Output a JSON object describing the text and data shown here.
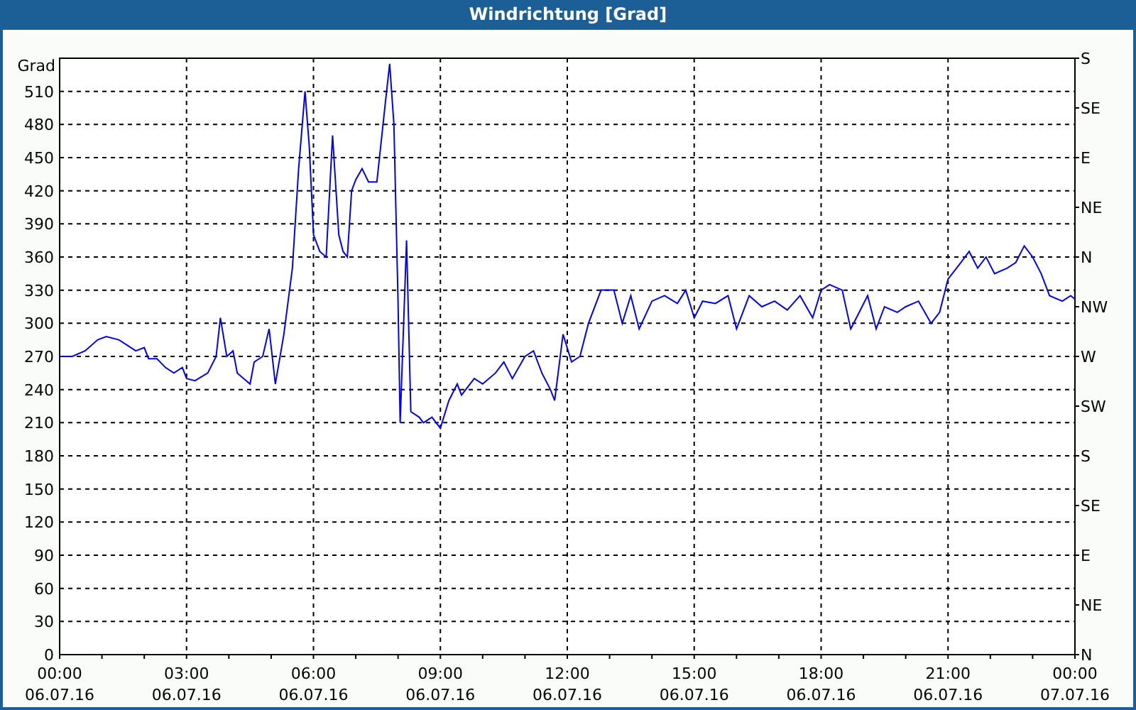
{
  "window": {
    "title": "Windrichtung [Grad]"
  },
  "chart": {
    "x_axis_dates": [
      "06.07.16",
      "06.07.16",
      "06.07.16",
      "06.07.16",
      "06.07.16",
      "06.07.16",
      "06.07.16",
      "06.07.16",
      "07.07.16"
    ],
    "compass_labels": [
      "S",
      "SE",
      "E",
      "NE",
      "N",
      "NW",
      "W",
      "SW",
      "S",
      "SE",
      "E",
      "NE",
      "N"
    ],
    "chart_data": {
      "type": "line",
      "grid": true,
      "ylabel": "Grad",
      "xlim": [
        0,
        24
      ],
      "ylim": [
        0,
        540
      ],
      "xticks": [
        {
          "value": 0,
          "label": "00:00"
        },
        {
          "value": 3,
          "label": "03:00"
        },
        {
          "value": 6,
          "label": "06:00"
        },
        {
          "value": 9,
          "label": "09:00"
        },
        {
          "value": 12,
          "label": "12:00"
        },
        {
          "value": 15,
          "label": "15:00"
        },
        {
          "value": 18,
          "label": "18:00"
        },
        {
          "value": 21,
          "label": "21:00"
        },
        {
          "value": 24,
          "label": "00:00"
        }
      ],
      "yticks": [
        0,
        30,
        60,
        90,
        120,
        150,
        180,
        210,
        240,
        270,
        300,
        330,
        360,
        390,
        420,
        450,
        480,
        510
      ],
      "x": [
        0,
        0.3,
        0.6,
        0.9,
        1.1,
        1.4,
        1.6,
        1.8,
        2.0,
        2.1,
        2.3,
        2.5,
        2.7,
        2.9,
        3.0,
        3.2,
        3.5,
        3.7,
        3.8,
        3.95,
        4.1,
        4.2,
        4.35,
        4.5,
        4.6,
        4.8,
        4.95,
        5.1,
        5.3,
        5.5,
        5.65,
        5.8,
        5.9,
        6.0,
        6.15,
        6.3,
        6.45,
        6.6,
        6.7,
        6.8,
        6.9,
        7.0,
        7.15,
        7.3,
        7.5,
        7.7,
        7.8,
        7.9,
        8.0,
        8.05,
        8.2,
        8.3,
        8.5,
        8.6,
        8.8,
        9.0,
        9.2,
        9.4,
        9.5,
        9.8,
        10.0,
        10.3,
        10.5,
        10.7,
        11.0,
        11.2,
        11.4,
        11.6,
        11.7,
        11.9,
        12.1,
        12.3,
        12.5,
        12.8,
        13.1,
        13.3,
        13.5,
        13.7,
        14.0,
        14.3,
        14.6,
        14.8,
        15.0,
        15.2,
        15.5,
        15.8,
        16.0,
        16.3,
        16.6,
        16.9,
        17.2,
        17.5,
        17.8,
        18.0,
        18.2,
        18.5,
        18.7,
        18.9,
        19.1,
        19.3,
        19.5,
        19.8,
        20.0,
        20.3,
        20.6,
        20.8,
        21.0,
        21.3,
        21.5,
        21.7,
        21.9,
        22.1,
        22.4,
        22.6,
        22.8,
        23.0,
        23.2,
        23.4,
        23.7,
        23.9,
        24.0
      ],
      "series": [
        {
          "color": "#0000ff",
          "values": [
            270,
            270,
            275,
            285,
            288,
            285,
            280,
            275,
            278,
            268,
            268,
            260,
            255,
            260,
            250,
            248,
            255,
            270,
            305,
            270,
            275,
            255,
            250,
            245,
            265,
            270,
            295,
            245,
            290,
            350,
            440,
            510,
            460,
            380,
            365,
            360,
            470,
            380,
            365,
            360,
            420,
            430,
            440,
            428,
            428,
            500,
            535,
            480,
            320,
            210,
            375,
            220,
            215,
            210,
            215,
            205,
            230,
            245,
            235,
            250,
            245,
            255,
            265,
            250,
            270,
            275,
            255,
            240,
            230,
            290,
            265,
            270,
            300,
            330,
            330,
            300,
            325,
            295,
            320,
            325,
            318,
            330,
            305,
            320,
            318,
            325,
            295,
            325,
            315,
            320,
            312,
            325,
            305,
            330,
            335,
            330,
            295,
            310,
            325,
            295,
            315,
            310,
            315,
            320,
            300,
            310,
            340,
            355,
            365,
            350,
            360,
            345,
            350,
            355,
            370,
            360,
            345,
            325,
            320,
            325,
            322
          ]
        }
      ]
    }
  }
}
